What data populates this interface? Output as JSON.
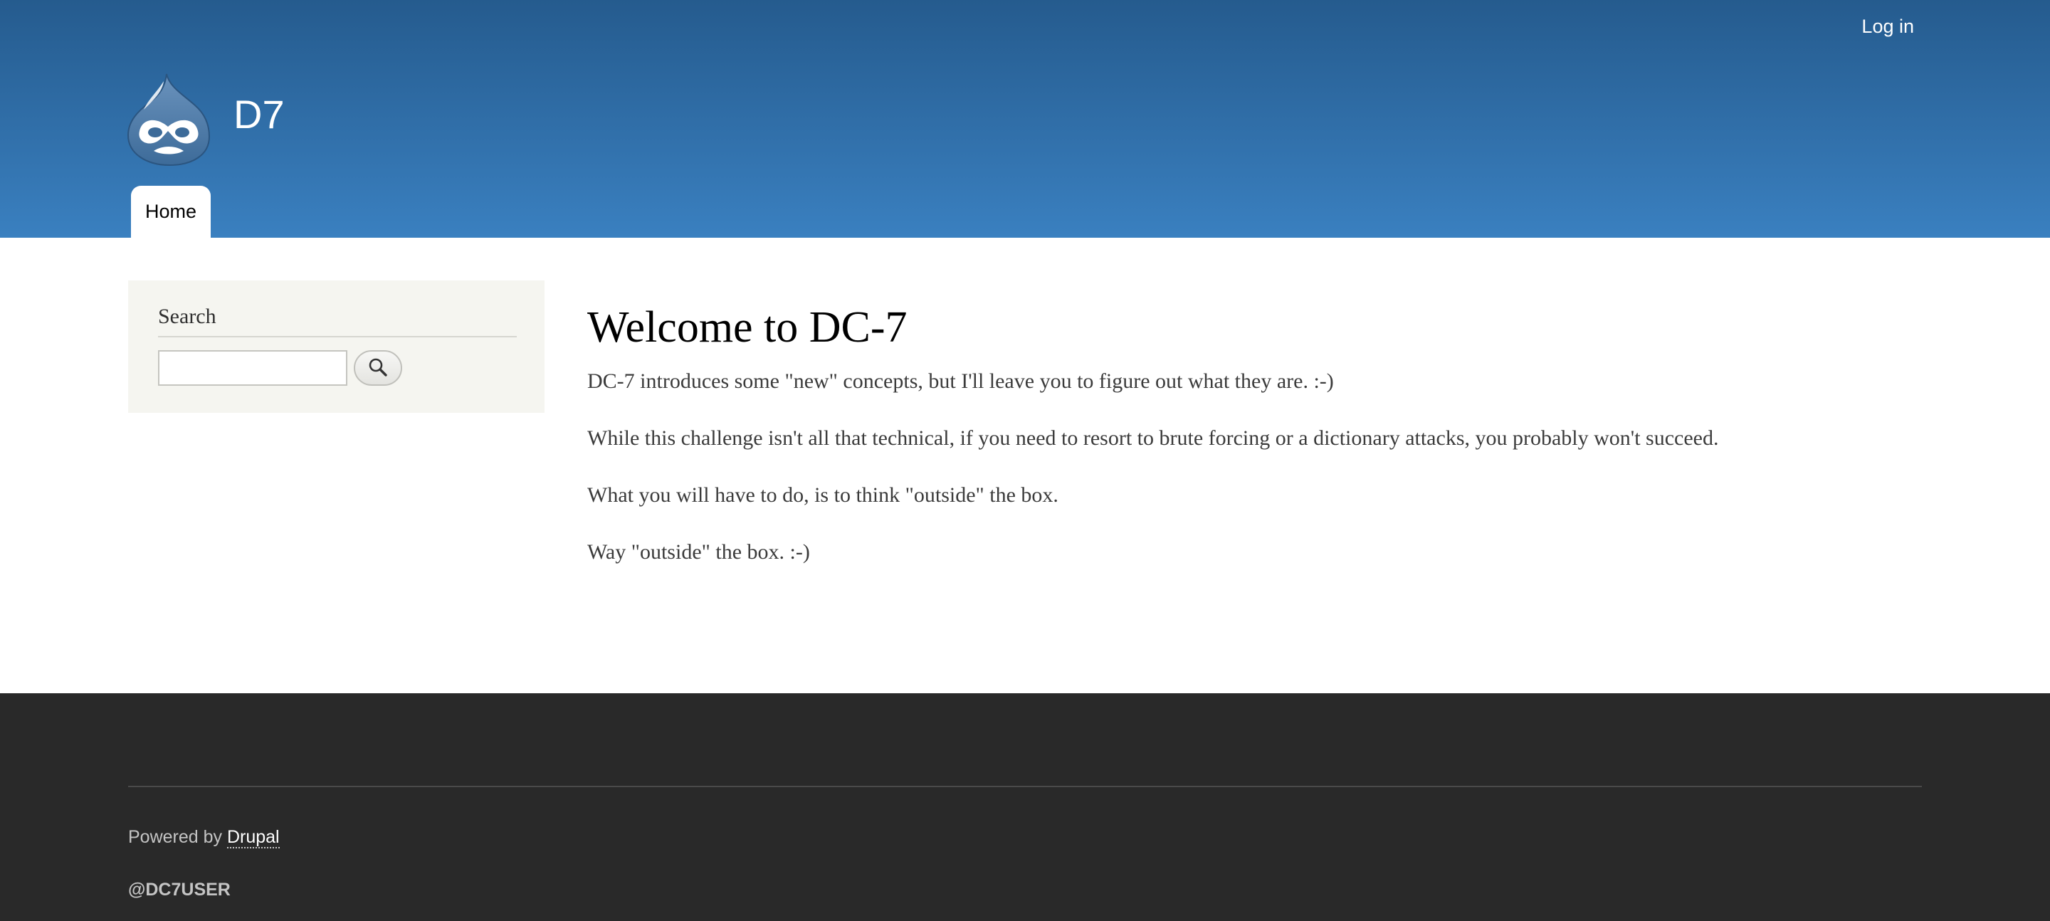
{
  "header": {
    "login_label": "Log in",
    "logo_icon": "drupal-drop-logo-icon",
    "site_name": "D7",
    "nav": {
      "home_label": "Home"
    },
    "colors": {
      "gradient_top": "#255b8e",
      "gradient_bottom": "#3a80c0"
    }
  },
  "sidebar": {
    "search": {
      "title": "Search",
      "input_value": "",
      "button_icon": "magnifier-icon"
    }
  },
  "main": {
    "title": "Welcome to DC-7",
    "paragraphs": [
      "DC-7 introduces some \"new\" concepts, but I'll leave you to figure out what they are.  :-)",
      "While this challenge isn't all that technical, if you need to resort to brute forcing or a dictionary attacks, you probably won't succeed.",
      "What you will have to do, is to think \"outside\" the box.",
      "Way \"outside\" the box.  :-)"
    ]
  },
  "footer": {
    "powered_by_prefix": "Powered by ",
    "powered_by_link": "Drupal",
    "user_tag": "@DC7USER",
    "background": "#292929"
  }
}
